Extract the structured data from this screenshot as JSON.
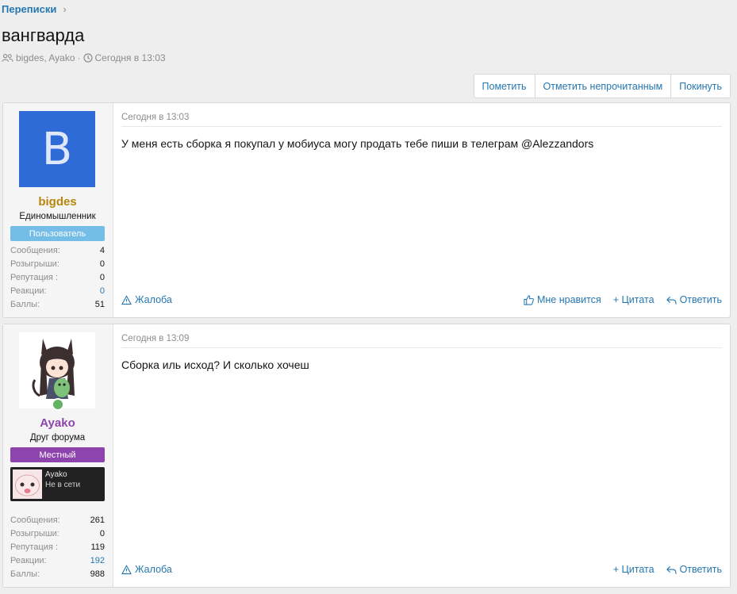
{
  "breadcrumb": {
    "label": "Переписки",
    "chevron": "›"
  },
  "title": "вангварда",
  "meta": {
    "participants_icon": "users-icon",
    "participants": "bigdes, Ayako",
    "separator": "·",
    "clock_icon": "clock-icon",
    "time": "Сегодня в 13:03"
  },
  "actions": {
    "mark": "Пометить",
    "mark_unread": "Отметить непрочитанным",
    "leave": "Покинуть"
  },
  "colors": {
    "link": "#2577b1",
    "bigdes_name": "#b8860b",
    "ayako_name": "#8e44ad",
    "user_banner": "#74bde6",
    "local_banner": "#8e44ad",
    "avatar_b": "#2e6bd6",
    "online": "#63b265"
  },
  "messages": [
    {
      "avatar_letter": "B",
      "username": "bigdes",
      "user_title": "Единомышленник",
      "banner": "Пользователь",
      "stats": [
        {
          "label": "Сообщения:",
          "value": "4"
        },
        {
          "label": "Розыгрыши:",
          "value": "0"
        },
        {
          "label": "Репутация :",
          "value": "0"
        },
        {
          "label": "Реакции:",
          "value": "0"
        },
        {
          "label": "Баллы:",
          "value": "51"
        }
      ],
      "date": "Сегодня в 13:03",
      "text": "У меня есть сборка я покупал у мобиуса могу продать тебе пиши в телеграм @Alezzandors",
      "report": "Жалоба",
      "like": "Мне нравится",
      "quote": "+ Цитата",
      "reply": "Ответить"
    },
    {
      "username": "Ayako",
      "user_title": "Друг форума",
      "banner": "Местный",
      "mini_card": {
        "name": "Ayako",
        "status": "Не в сети"
      },
      "stats": [
        {
          "label": "Сообщения:",
          "value": "261"
        },
        {
          "label": "Розыгрыши:",
          "value": "0"
        },
        {
          "label": "Репутация :",
          "value": "119"
        },
        {
          "label": "Реакции:",
          "value": "192"
        },
        {
          "label": "Баллы:",
          "value": "988"
        }
      ],
      "date": "Сегодня в 13:09",
      "text": "Сборка иль исход? И сколько хочеш",
      "report": "Жалоба",
      "quote": "+ Цитата",
      "reply": "Ответить"
    }
  ]
}
